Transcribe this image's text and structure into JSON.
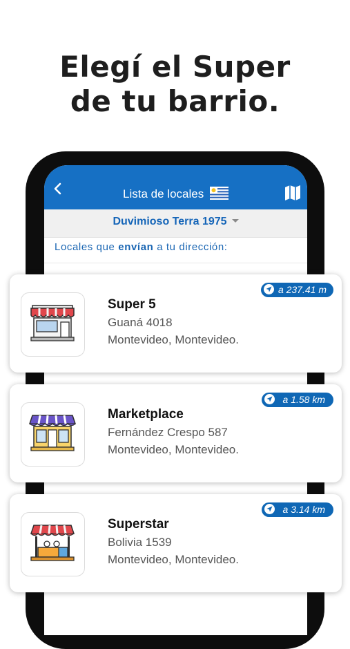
{
  "headline": {
    "line1": "Elegí el Super",
    "line2": "de tu barrio."
  },
  "topbar": {
    "title": "Lista de locales",
    "back_icon": "chevron-left-icon",
    "map_icon": "map-icon",
    "flag_icon": "uruguay-flag-icon"
  },
  "address": {
    "value": "Duvimioso Terra 1975"
  },
  "section": {
    "prefix": "Locales que",
    "emphasis": "envían",
    "suffix": "a tu dirección:"
  },
  "colors": {
    "brand_blue": "#1670c4",
    "badge_blue": "#0f67b5"
  },
  "stores": [
    {
      "name": "Super 5",
      "street": "Guaná 4018",
      "city": "Montevideo, Montevideo.",
      "distance": "a 237.41 m",
      "icon": "red-awning-store-icon"
    },
    {
      "name": "Marketplace",
      "street": "Fernández Crespo 587",
      "city": "Montevideo, Montevideo.",
      "distance": "a 1.58 km",
      "icon": "purple-awning-store-icon"
    },
    {
      "name": "Superstar",
      "street": "Bolivia 1539",
      "city": "Montevideo, Montevideo.",
      "distance": "a 3.14 km",
      "icon": "market-stall-icon"
    }
  ]
}
